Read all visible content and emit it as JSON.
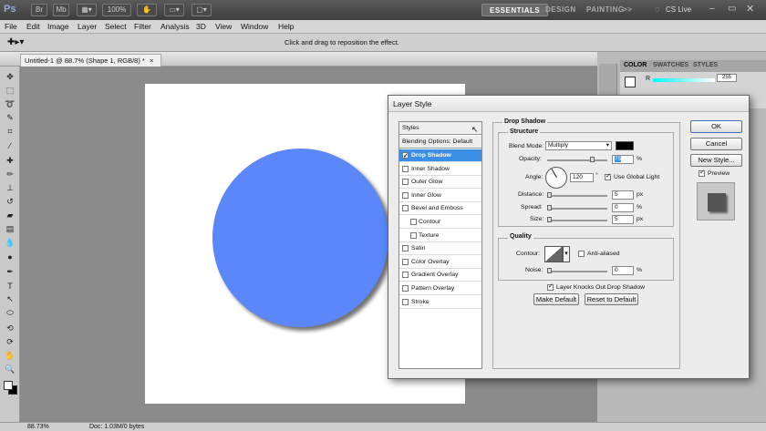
{
  "appbar": {
    "logo": "Ps",
    "zoom": "100%",
    "workspaces": [
      "ESSENTIALS",
      "DESIGN",
      "PAINTING"
    ],
    "more": ">>",
    "cs_live": "CS Live"
  },
  "menu": [
    "File",
    "Edit",
    "Image",
    "Layer",
    "Select",
    "Filter",
    "Analysis",
    "3D",
    "View",
    "Window",
    "Help"
  ],
  "options_bar": {
    "hint": "Click and drag to reposition the effect."
  },
  "document": {
    "tab_title": "Untitled-1 @ 88.7% (Shape 1, RGB/8) *",
    "zoom": "88.73%",
    "doc_info": "Doc: 1.03M/0 bytes"
  },
  "panels": {
    "tabs": [
      "COLOR",
      "SWATCHES",
      "STYLES"
    ],
    "color_r_value": "255",
    "color_r_label": "R"
  },
  "colors": {
    "shape_fill": "#5b87f8",
    "selection": "#3b8fe4",
    "app_dark": "#3e3e3e"
  },
  "dialog": {
    "title": "Layer Style",
    "styles_header": "Styles",
    "blending_options": "Blending Options: Default",
    "effects": [
      {
        "label": "Drop Shadow",
        "checked": true,
        "selected": true,
        "sub": false
      },
      {
        "label": "Inner Shadow",
        "checked": false,
        "selected": false,
        "sub": false
      },
      {
        "label": "Outer Glow",
        "checked": false,
        "selected": false,
        "sub": false
      },
      {
        "label": "Inner Glow",
        "checked": false,
        "selected": false,
        "sub": false
      },
      {
        "label": "Bevel and Emboss",
        "checked": false,
        "selected": false,
        "sub": false
      },
      {
        "label": "Contour",
        "checked": false,
        "selected": false,
        "sub": true
      },
      {
        "label": "Texture",
        "checked": false,
        "selected": false,
        "sub": true
      },
      {
        "label": "Satin",
        "checked": false,
        "selected": false,
        "sub": false
      },
      {
        "label": "Color Overlay",
        "checked": false,
        "selected": false,
        "sub": false
      },
      {
        "label": "Gradient Overlay",
        "checked": false,
        "selected": false,
        "sub": false
      },
      {
        "label": "Pattern Overlay",
        "checked": false,
        "selected": false,
        "sub": false
      },
      {
        "label": "Stroke",
        "checked": false,
        "selected": false,
        "sub": false
      }
    ],
    "section_title": "Drop Shadow",
    "structure": {
      "title": "Structure",
      "blend_mode_label": "Blend Mode:",
      "blend_mode_value": "Multiply",
      "opacity_label": "Opacity:",
      "opacity_value": "75",
      "opacity_unit": "%",
      "angle_label": "Angle:",
      "angle_value": "120",
      "angle_unit": "°",
      "global_light_label": "Use Global Light",
      "distance_label": "Distance:",
      "distance_value": "5",
      "distance_unit": "px",
      "spread_label": "Spread:",
      "spread_value": "0",
      "spread_unit": "%",
      "size_label": "Size:",
      "size_value": "5",
      "size_unit": "px"
    },
    "quality": {
      "title": "Quality",
      "contour_label": "Contour:",
      "anti_aliased_label": "Anti-aliased",
      "noise_label": "Noise:",
      "noise_value": "0",
      "noise_unit": "%"
    },
    "knockout_label": "Layer Knocks Out Drop Shadow",
    "make_default": "Make Default",
    "reset_default": "Reset to Default",
    "ok": "OK",
    "cancel": "Cancel",
    "new_style": "New Style...",
    "preview_label": "Preview"
  }
}
